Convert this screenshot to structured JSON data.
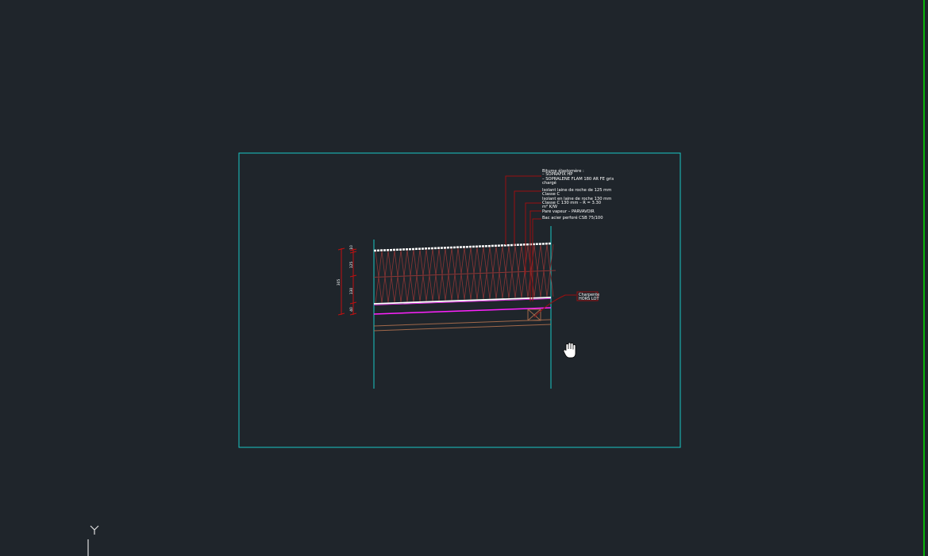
{
  "viewport": {
    "background": "#1f252b",
    "frame_color": "#19c6c6",
    "ucs_axis_label": "Y",
    "right_edge_color": "#00e000"
  },
  "annotation": {
    "lines": [
      "Bitume élastomère :",
      "– SOPRAFIX HP",
      "– SOPRALENE FLAM 180 AR FE gris",
      "chargé",
      "Isolant laine de roche de 125 mm",
      "Classe C",
      "Isolant en laine de roche 130 mm",
      "Classe C 130 mm – R = 3.30",
      "m² K/W",
      "Pare vapeur – PARVAVOIR",
      "Bac acier perforé CSB 75/100"
    ]
  },
  "structure_label": {
    "line1": "Charpente",
    "line2": "HORS LOT"
  },
  "dimensions": {
    "total": "305",
    "layers": [
      "10",
      "125",
      "130",
      "40"
    ]
  },
  "cursor": "hand-pan-icon"
}
